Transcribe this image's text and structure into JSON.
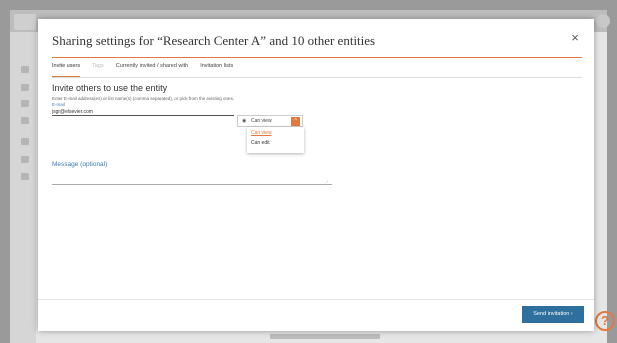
{
  "modal": {
    "title": "Sharing settings for “Research Center A” and 10 other entities",
    "close_label": "×",
    "tabs": [
      {
        "label": "Invite users"
      },
      {
        "label": "Tags"
      },
      {
        "label": "Currently invited / shared with"
      },
      {
        "label": "Invitation lists"
      }
    ],
    "invite": {
      "heading": "Invite others to use the entity",
      "help": "Enter E-mail address(es) or list name(s) (comma separated), or pick from the existing ones.",
      "email_label": "E-mail",
      "email_value": "jsgr@elsevier.com",
      "permission": {
        "selected": "Can view",
        "chevron": "^",
        "eye": "◉",
        "options": [
          "Can view",
          "Can edit"
        ]
      },
      "message_label": "Message (optional)",
      "resize_glyph": "∕"
    },
    "send_label": "Send invitation  ›"
  },
  "background": {
    "help_icon": "?"
  }
}
